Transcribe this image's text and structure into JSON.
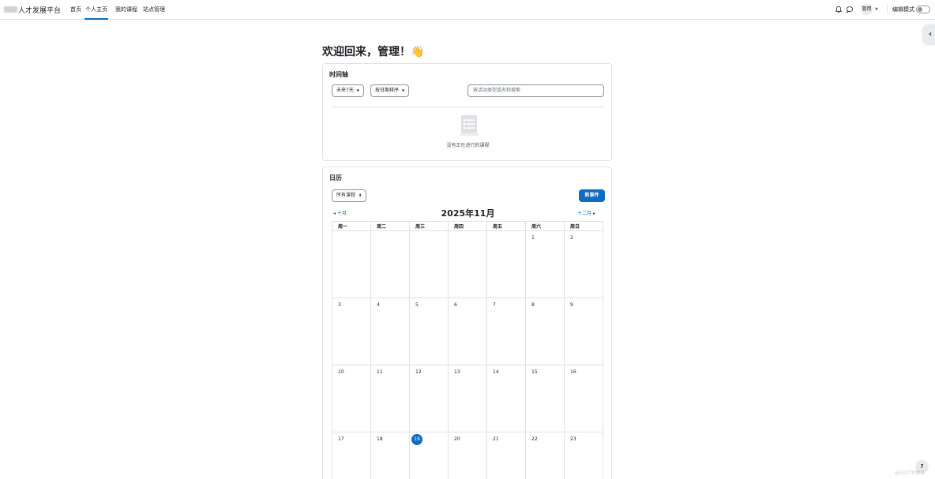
{
  "navbar": {
    "brand": "人才发展平台",
    "links": [
      {
        "label": "首页",
        "active": false
      },
      {
        "label": "个人主页",
        "active": true
      },
      {
        "label": "我的课程",
        "active": false
      },
      {
        "label": "站点管理",
        "active": false
      }
    ],
    "user_label": "管用",
    "edit_mode_label": "编辑模式"
  },
  "welcome": "欢迎回来，管理！👋",
  "timeline": {
    "title": "时间轴",
    "filter_label": "未来7天",
    "sort_label": "按日期排序",
    "search_placeholder": "按活动类型或名称搜索",
    "empty_text": "没有正在进行的课程"
  },
  "calendar": {
    "title": "日历",
    "course_filter": "所有课程",
    "new_event_label": "新事件",
    "prev_month": "◂ 十月",
    "next_month": "十二月 ▸",
    "month_title": "2025年11月",
    "weekdays": [
      "周一",
      "周二",
      "周三",
      "周四",
      "周五",
      "周六",
      "周日"
    ],
    "weeks": [
      [
        "",
        "",
        "",
        "",
        "",
        "1",
        "2"
      ],
      [
        "3",
        "4",
        "5",
        "6",
        "7",
        "8",
        "9"
      ],
      [
        "10",
        "11",
        "12",
        "13",
        "14",
        "15",
        "16"
      ],
      [
        "17",
        "18",
        "19",
        "20",
        "21",
        "22",
        "23"
      ]
    ],
    "today": "19",
    "accent_color": "#0f6cbf"
  },
  "help_label": "?",
  "watermark": "@51CTO博客"
}
